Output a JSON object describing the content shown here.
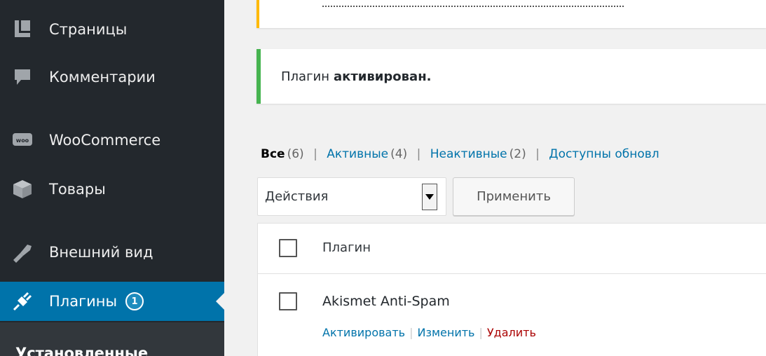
{
  "sidebar": {
    "items": [
      {
        "label": "Страницы",
        "icon": "pages-icon"
      },
      {
        "label": "Комментарии",
        "icon": "comments-icon"
      },
      {
        "label": "WooCommerce",
        "icon": "woocommerce-icon"
      },
      {
        "label": "Товары",
        "icon": "products-icon"
      },
      {
        "label": "Внешний вид",
        "icon": "appearance-icon"
      },
      {
        "label": "Плагины",
        "icon": "plugins-icon",
        "badge": "1",
        "active": true
      }
    ],
    "submenu": {
      "installed": "Установленные"
    },
    "colors": {
      "background": "#23282d",
      "active": "#0073aa",
      "text": "#eeeeee"
    }
  },
  "notices": {
    "success_prefix": "Плагин",
    "success_bold": "активирован."
  },
  "filters": {
    "all_label": "Все",
    "all_count": "(6)",
    "active_label": "Активные",
    "active_count": "(4)",
    "inactive_label": "Неактивные",
    "inactive_count": "(2)",
    "updates_label": "Доступны обновл",
    "separator": "|"
  },
  "bulk": {
    "select_value": "Действия",
    "apply_label": "Применить"
  },
  "table": {
    "column_plugin": "Плагин",
    "rows": [
      {
        "name": "Akismet Anti-Spam",
        "actions": {
          "activate": "Активировать",
          "edit": "Изменить",
          "delete": "Удалить"
        }
      }
    ]
  }
}
